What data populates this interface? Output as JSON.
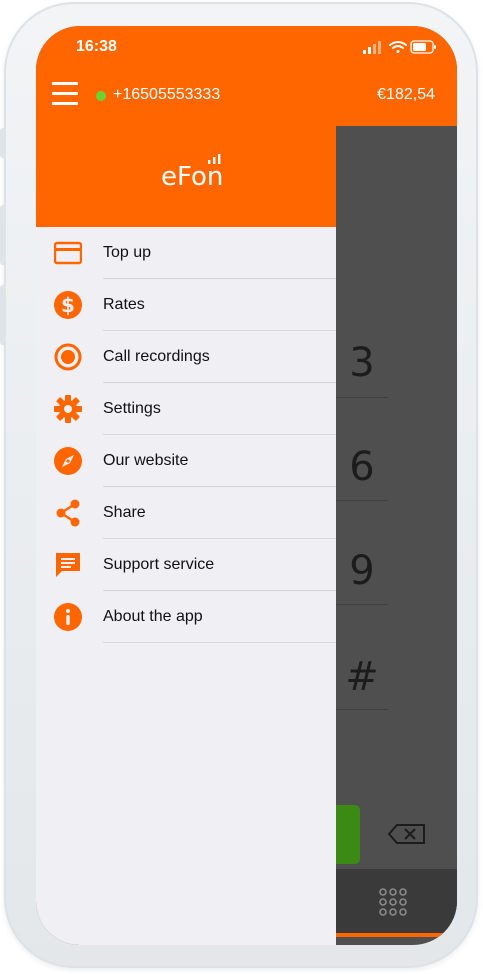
{
  "status_bar": {
    "time": "16:38"
  },
  "header": {
    "phone_number": "+16505553333",
    "balance": "€182,54"
  },
  "drawer": {
    "logo": "eFon",
    "items": [
      {
        "label": "Top up",
        "icon": "credit-card-icon"
      },
      {
        "label": "Rates",
        "icon": "dollar-icon"
      },
      {
        "label": "Call recordings",
        "icon": "record-icon"
      },
      {
        "label": "Settings",
        "icon": "gear-icon"
      },
      {
        "label": "Our website",
        "icon": "compass-icon"
      },
      {
        "label": "Share",
        "icon": "share-icon"
      },
      {
        "label": "Support service",
        "icon": "chat-icon"
      },
      {
        "label": "About the app",
        "icon": "info-icon"
      }
    ]
  },
  "dialer": {
    "keys": [
      "3",
      "6",
      "9",
      "#"
    ]
  },
  "colors": {
    "accent": "#ff6600",
    "online": "#6ad432",
    "call": "#3a8a14"
  }
}
